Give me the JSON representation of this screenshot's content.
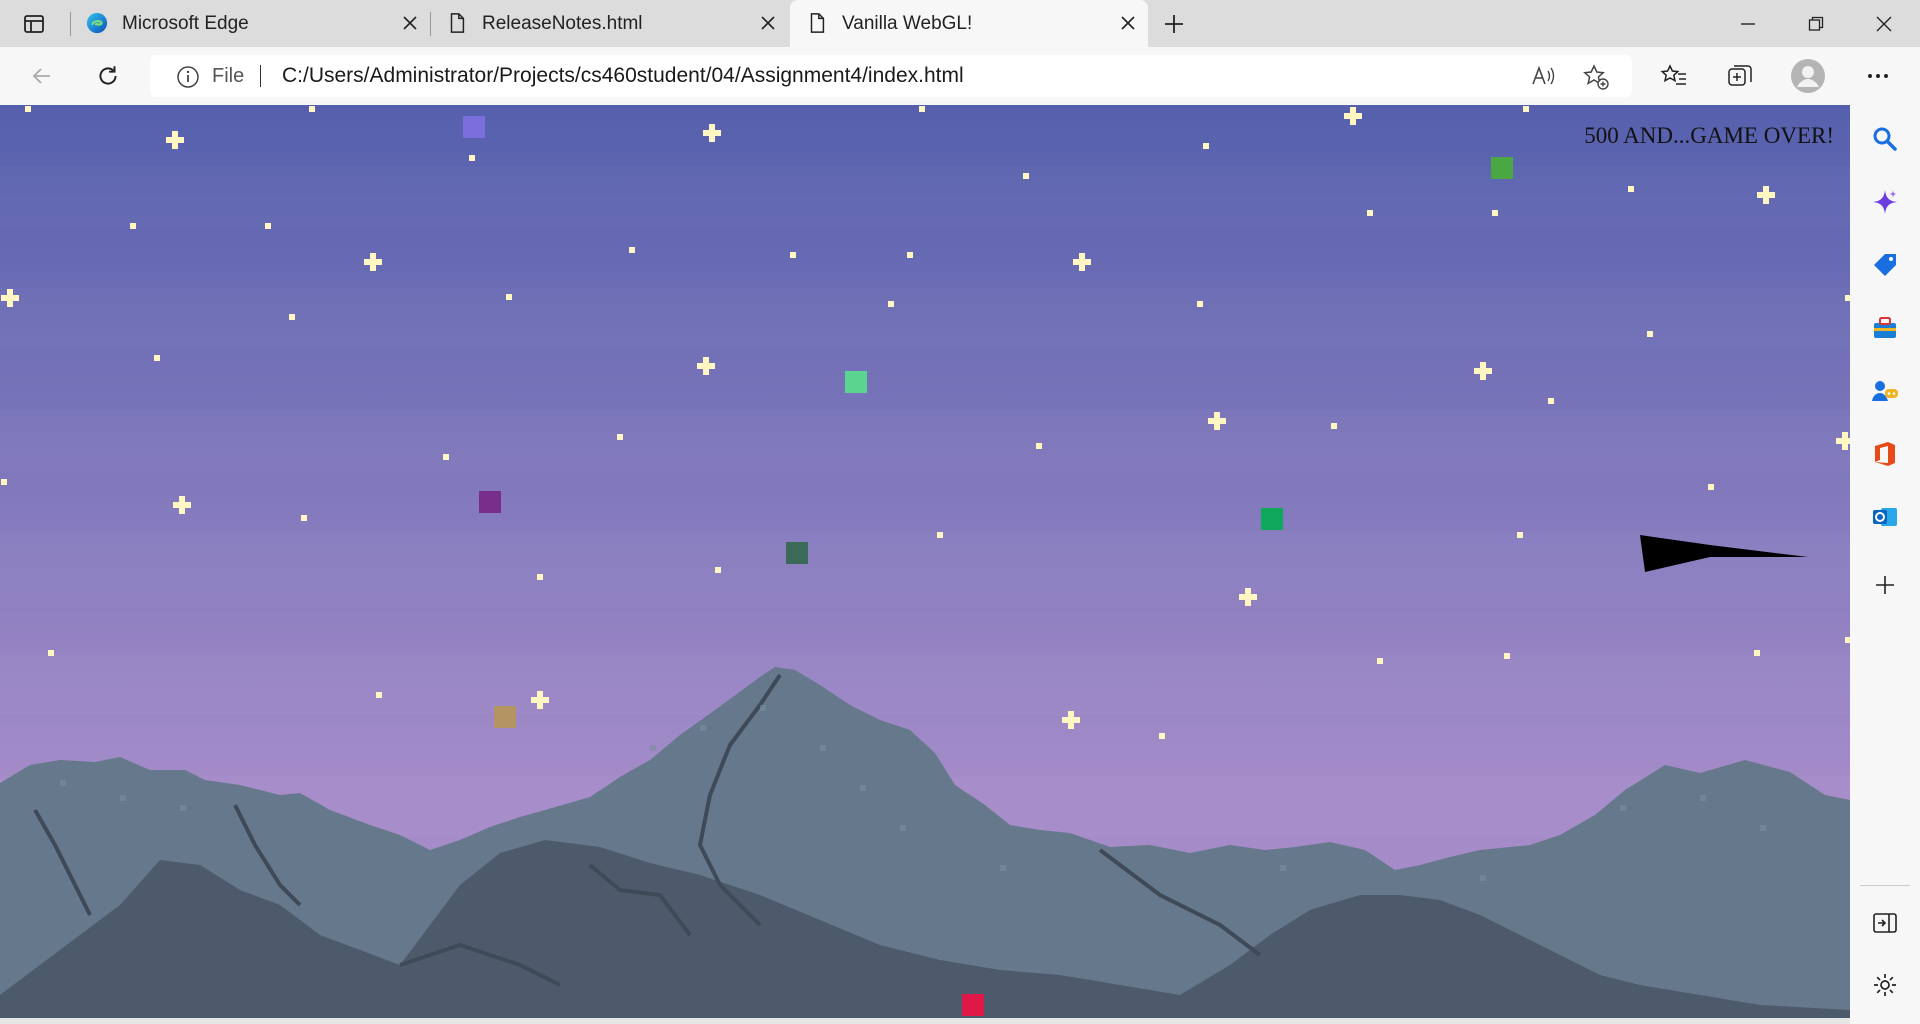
{
  "browser": {
    "tabs": [
      {
        "title": "Microsoft Edge",
        "icon": "edge-logo-icon",
        "active": false
      },
      {
        "title": "ReleaseNotes.html",
        "icon": "file-icon",
        "active": false
      },
      {
        "title": "Vanilla WebGL!",
        "icon": "file-icon",
        "active": true
      }
    ],
    "address": {
      "scheme_label": "File",
      "url": "C:/Users/Administrator/Projects/cs460student/04/Assignment4/index.html"
    },
    "sidebar_items": [
      "search-icon",
      "copilot-icon",
      "shopping-tag-icon",
      "tools-icon",
      "games-icon",
      "office-icon",
      "outlook-icon",
      "add-icon"
    ]
  },
  "game": {
    "status_text": "500 AND...GAME OVER!",
    "colors": {
      "sky_top": "#5560ad",
      "sky_bottom": "#a58cc9",
      "mountain_light": "#66788c",
      "mountain_dark": "#4d5a6b",
      "star": "#fff6c2",
      "ship": "#000000"
    },
    "squares": [
      {
        "name": "lavender-square",
        "color": "#7b6fdd"
      },
      {
        "name": "green-square-top-right",
        "color": "#4aa843"
      },
      {
        "name": "mint-square",
        "color": "#5ad48f"
      },
      {
        "name": "purple-square",
        "color": "#7a2e8c"
      },
      {
        "name": "emerald-square",
        "color": "#10a85a"
      },
      {
        "name": "dark-green-square",
        "color": "#3c6a58"
      },
      {
        "name": "tan-square",
        "color": "#b39462"
      },
      {
        "name": "red-square",
        "color": "#e01848"
      }
    ]
  }
}
